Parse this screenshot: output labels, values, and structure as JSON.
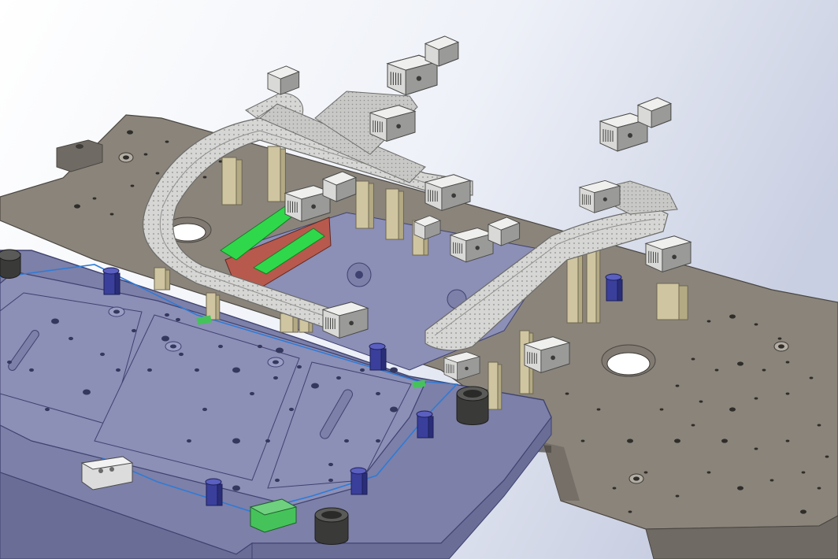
{
  "scene": {
    "kind": "cad-3d-assembly-view",
    "shading": "shaded-with-edges",
    "background_gradient": [
      "#ffffff",
      "#eef1f8",
      "#c9cfe2"
    ],
    "colors": {
      "base_plate": "#807a72",
      "base_plate_edge": "#4a4641",
      "base_plate_top_face": "#8a847b",
      "side_frame": "#6f6a64",
      "fixture_plate": "#7d80a8",
      "fixture_plate_edge": "#3f4270",
      "fixture_inner_plate": "#8c8fb6",
      "track_silver": "#d6d6d4",
      "track_dark": "#8f8f8d",
      "green_belt": "#2fd84a",
      "red_insert": "#b8594d",
      "tan_posts": "#cfc5a0",
      "navy_pins": "#3a3f9b",
      "dark_bushing": "#3a3a38",
      "blue_wire": "#2f7bd6",
      "green_block": "#45c35a"
    },
    "visible_components": [
      "base-plate",
      "fixture-plate",
      "upper-conveyor-track",
      "lower-conveyor-track",
      "green-belts",
      "red-insert",
      "support-posts",
      "locating-pins",
      "pneumatic-grippers",
      "floating-gripper-assemblies",
      "bushings",
      "cable-route"
    ]
  }
}
